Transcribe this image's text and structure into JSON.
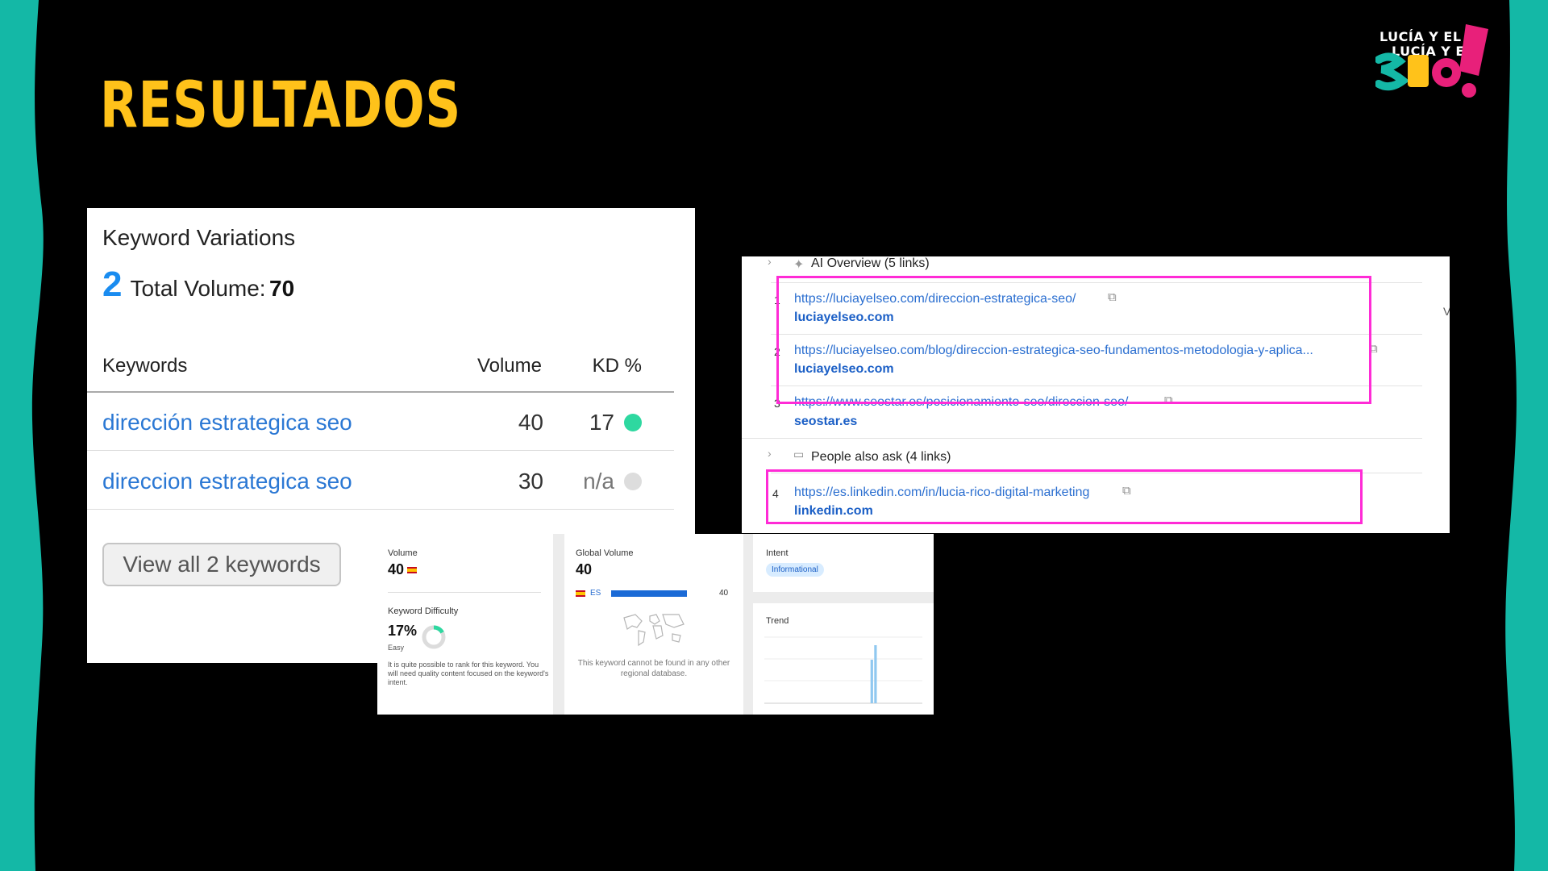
{
  "slide": {
    "title": "RESULTADOS"
  },
  "logo": {
    "line1": "LUCÍA Y EL",
    "line2": "LUCÍA Y EL",
    "mark": "SEO!"
  },
  "colors": {
    "teal": "#14B8A6",
    "title_yellow": "#FFC21A",
    "highlight": "#FF2BD6",
    "kd_easy": "#2ED8A0",
    "kd_na": "#DDDDDD"
  },
  "keyword_variations": {
    "title": "Keyword Variations",
    "count": "2",
    "total_volume_label": "Total Volume:",
    "total_volume_value": "70",
    "headers": {
      "keyword": "Keywords",
      "volume": "Volume",
      "kd": "KD %"
    },
    "rows": [
      {
        "keyword": "dirección estrategica seo",
        "volume": "40",
        "kd": "17",
        "kd_status": "easy"
      },
      {
        "keyword": "direccion estrategica seo",
        "volume": "30",
        "kd": "n/a",
        "kd_status": "none"
      }
    ],
    "view_all_label": "View all 2 keywords"
  },
  "overview": {
    "volume": {
      "label": "Volume",
      "value": "40"
    },
    "keyword_difficulty": {
      "label": "Keyword Difficulty",
      "value": "17%",
      "level": "Easy",
      "percent": 17,
      "description": "It is quite possible to rank for this keyword. You will need quality content focused on the keyword's intent."
    },
    "global_volume": {
      "label": "Global Volume",
      "value": "40",
      "countries": [
        {
          "code": "ES",
          "value": "40",
          "share": 1.0
        }
      ],
      "map_note": "This keyword cannot be found in any other regional database."
    },
    "intent": {
      "label": "Intent",
      "badge": "Informational"
    },
    "trend": {
      "label": "Trend",
      "values": [
        0,
        0,
        0,
        0,
        0,
        0,
        0,
        0,
        0,
        0,
        0,
        0,
        0,
        0,
        0,
        0,
        0,
        0,
        0,
        0,
        0,
        0,
        0,
        0,
        0,
        0,
        0,
        0,
        0.75,
        1,
        0,
        0,
        0,
        0,
        0,
        0,
        0,
        0,
        0,
        0,
        0,
        0
      ]
    }
  },
  "serp": {
    "ai_overview_label": "AI Overview (5 links)",
    "people_also_ask_label": "People also ask (4 links)",
    "right_edge_letters": "V",
    "results": [
      {
        "num": "1",
        "url": "https://luciayelseo.com/direccion-estrategica-seo/",
        "domain": "luciayelseo.com"
      },
      {
        "num": "2",
        "url": "https://luciayelseo.com/blog/direccion-estrategica-seo-fundamentos-metodologia-y-aplica...",
        "domain": "luciayelseo.com"
      },
      {
        "num": "3",
        "url": "https://www.seostar.es/posicionamiento-seo/direccion-seo/",
        "domain": "seostar.es"
      },
      {
        "num": "4",
        "url": "https://es.linkedin.com/in/lucia-rico-digital-marketing",
        "domain": "linkedin.com"
      }
    ]
  }
}
